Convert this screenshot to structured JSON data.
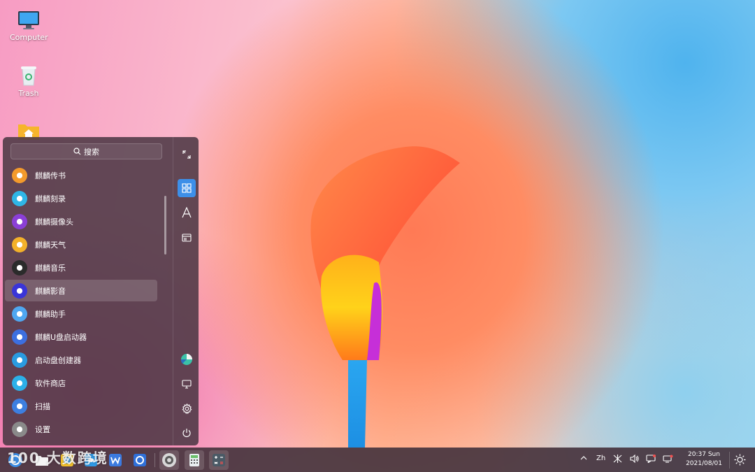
{
  "desktop": {
    "icons": [
      {
        "label": "Computer",
        "icon": "monitor-icon"
      },
      {
        "label": "Trash",
        "icon": "trash-icon"
      },
      {
        "label": "",
        "icon": "home-folder-icon"
      }
    ]
  },
  "start_menu": {
    "search_placeholder": "搜索",
    "apps": [
      {
        "label": "麒麟传书",
        "icon": "paper-plane-icon",
        "color": "#f39a2c"
      },
      {
        "label": "麒麟刻录",
        "icon": "disc-burner-icon",
        "color": "#2fb6e6"
      },
      {
        "label": "麒麟摄像头",
        "icon": "camera-icon",
        "color": "#8b3fd6"
      },
      {
        "label": "麒麟天气",
        "icon": "weather-icon",
        "color": "#f3b12a"
      },
      {
        "label": "麒麟音乐",
        "icon": "music-icon",
        "color": "#2b2b2b"
      },
      {
        "label": "麒麟影音",
        "icon": "video-player-icon",
        "color": "#3a35d8"
      },
      {
        "label": "麒麟助手",
        "icon": "assistant-icon",
        "color": "#4fa7f0"
      },
      {
        "label": "麒麟U盘启动器",
        "icon": "usb-icon",
        "color": "#3c6fe0"
      },
      {
        "label": "启动盘创建器",
        "icon": "boot-disk-icon",
        "color": "#2a9be0"
      },
      {
        "label": "软件商店",
        "icon": "software-store-icon",
        "color": "#2cb0e8"
      },
      {
        "label": "扫描",
        "icon": "scanner-icon",
        "color": "#3d7fe0"
      },
      {
        "label": "设置",
        "icon": "settings-gear-icon",
        "color": "#8a8a8a"
      }
    ],
    "selected_index": 5,
    "side_buttons": [
      {
        "name": "expand-icon"
      },
      {
        "name": "all-apps-grid-icon",
        "active": true
      },
      {
        "name": "alphabet-sort-icon"
      },
      {
        "name": "category-icon"
      },
      {
        "name": "user-avatar-icon"
      },
      {
        "name": "computer-icon"
      },
      {
        "name": "settings-icon"
      },
      {
        "name": "power-icon"
      }
    ]
  },
  "taskbar": {
    "watermark": "100 大数跨境",
    "apps": [
      {
        "name": "kylin-start-icon"
      },
      {
        "name": "file-manager-icon"
      },
      {
        "name": "photos-icon"
      },
      {
        "name": "browser-icon"
      },
      {
        "name": "wps-writer-icon"
      },
      {
        "name": "search-app-icon"
      },
      {
        "name": "settings-app-icon",
        "open": true
      },
      {
        "name": "calculator-app-icon",
        "open": true
      },
      {
        "name": "calculator-icon",
        "open": true
      }
    ],
    "tray": {
      "input_method": "Zh",
      "time": "20:37 Sun",
      "date": "2021/08/01"
    }
  }
}
